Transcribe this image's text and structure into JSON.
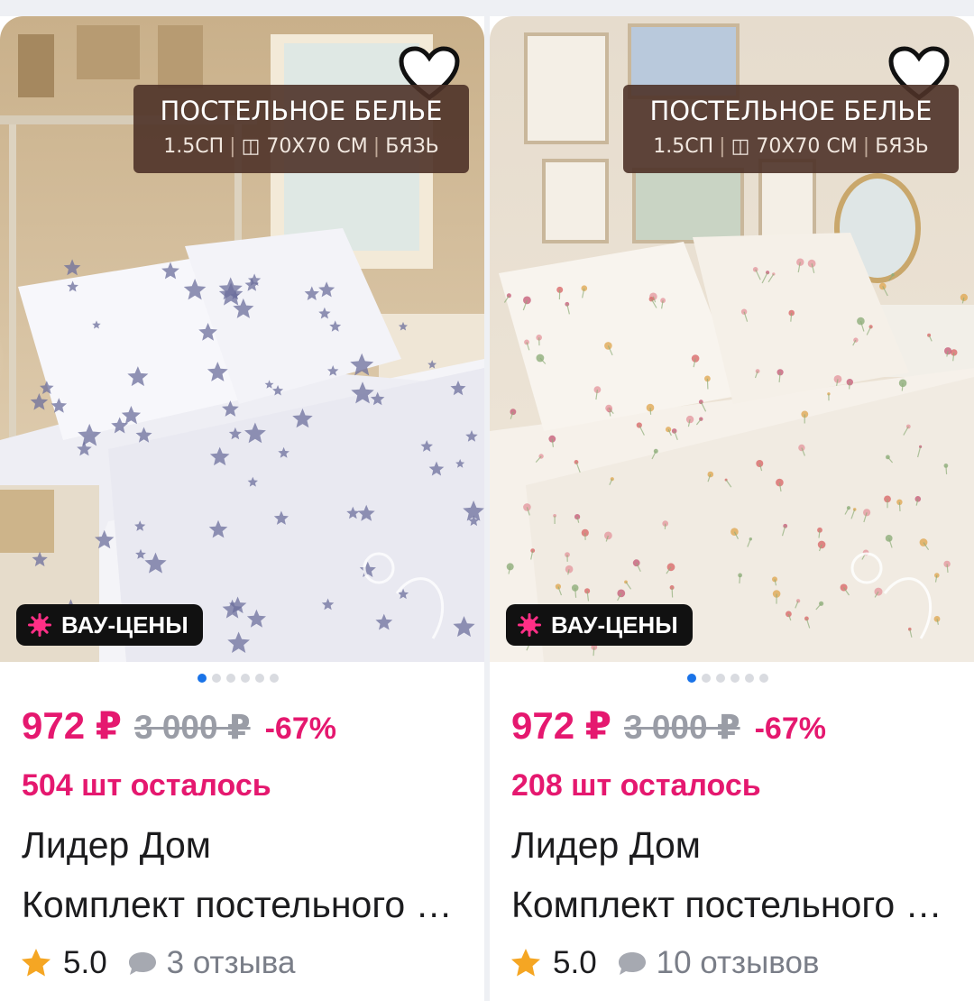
{
  "products": [
    {
      "banner": {
        "title": "ПОСТЕЛЬНОЕ БЕЛЬЕ",
        "size": "1.5СП",
        "pillow": "70Х70 СМ",
        "fabric": "БЯЗЬ"
      },
      "badge": "ВАУ-ЦЕНЫ",
      "price": "972 ₽",
      "old_price": "3 000 ₽",
      "discount": "-67%",
      "stock": "504 шт осталось",
      "brand": "Лидер Дом",
      "title": "Комплект постельного белья",
      "rating": "5.0",
      "reviews": "3 отзыва",
      "pattern": "stars",
      "icons": [
        "heart-icon",
        "burst-icon",
        "star-icon",
        "comment-icon"
      ]
    },
    {
      "banner": {
        "title": "ПОСТЕЛЬНОЕ БЕЛЬЕ",
        "size": "1.5СП",
        "pillow": "70Х70 СМ",
        "fabric": "БЯЗЬ"
      },
      "badge": "ВАУ-ЦЕНЫ",
      "price": "972 ₽",
      "old_price": "3 000 ₽",
      "discount": "-67%",
      "stock": "208 шт осталось",
      "brand": "Лидер Дом",
      "title": "Комплект постельного белья",
      "rating": "5.0",
      "reviews": "10 отзывов",
      "pattern": "flowers",
      "icons": [
        "heart-icon",
        "burst-icon",
        "star-icon",
        "comment-icon"
      ]
    }
  ],
  "colors": {
    "accent": "#e5186f",
    "muted": "#9a9da6",
    "dot_active": "#1a73e8",
    "badge_bg": "#111111",
    "star": "#f5a623"
  }
}
